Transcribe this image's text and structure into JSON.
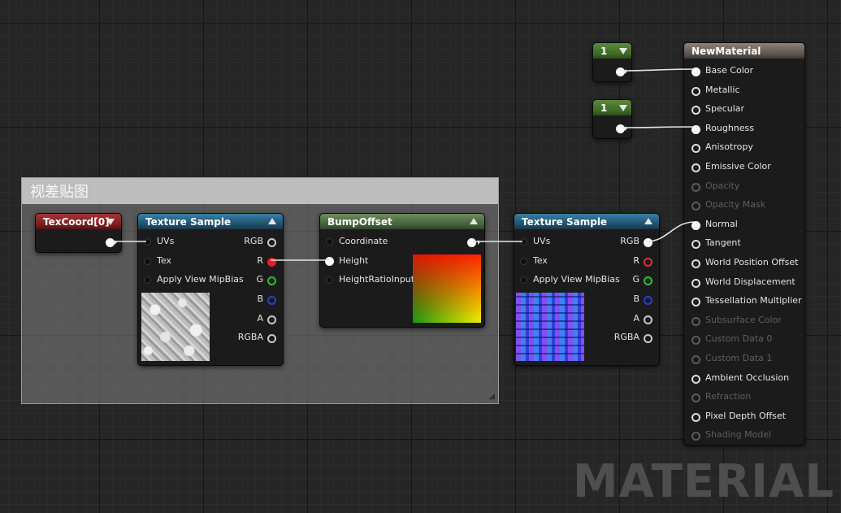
{
  "comment": {
    "title": "视差贴图"
  },
  "texcoord": {
    "title": "TexCoord[0]"
  },
  "tex1": {
    "title": "Texture Sample",
    "inputs": [
      "UVs",
      "Tex",
      "Apply View MipBias"
    ],
    "outputs": [
      "RGB",
      "R",
      "G",
      "B",
      "A",
      "RGBA"
    ]
  },
  "bump": {
    "title": "BumpOffset",
    "inputs": [
      "Coordinate",
      "Height",
      "HeightRatioInput"
    ]
  },
  "tex2": {
    "title": "Texture Sample",
    "inputs": [
      "UVs",
      "Tex",
      "Apply View MipBias"
    ],
    "outputs": [
      "RGB",
      "R",
      "G",
      "B",
      "A",
      "RGBA"
    ]
  },
  "const1": {
    "value": "1"
  },
  "const2": {
    "value": "1"
  },
  "material": {
    "title": "NewMaterial",
    "pins": [
      "Base Color",
      "Metallic",
      "Specular",
      "Roughness",
      "Anisotropy",
      "Emissive Color",
      "Opacity",
      "Opacity Mask",
      "Normal",
      "Tangent",
      "World Position Offset",
      "World Displacement",
      "Tessellation Multiplier",
      "Subsurface Color",
      "Custom Data 0",
      "Custom Data 1",
      "Ambient Occlusion",
      "Refraction",
      "Pixel Depth Offset",
      "Shading Model"
    ],
    "disabled_pins": [
      "Opacity",
      "Opacity Mask",
      "Subsurface Color",
      "Custom Data 0",
      "Custom Data 1",
      "Refraction",
      "Shading Model"
    ]
  },
  "watermark": "MATERIAL",
  "colors": {
    "texture_header": "#2a6a8e",
    "texcoord_header": "#8e2a2a",
    "bump_header": "#4f6e45",
    "material_header": "#6e645c",
    "constant_header": "#4a7a2e",
    "r_pin": "#e62020",
    "g_pin": "#30c030",
    "b_pin": "#2a3fd8"
  }
}
